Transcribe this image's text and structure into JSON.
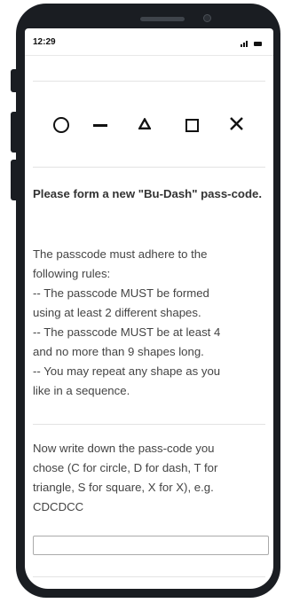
{
  "status_bar": {
    "time": "12:29"
  },
  "shapes": [
    {
      "name": "circle",
      "glyph": "circle-icon"
    },
    {
      "name": "dash",
      "glyph": "dash-icon"
    },
    {
      "name": "triangle",
      "glyph": "triangle-icon"
    },
    {
      "name": "square",
      "glyph": "square-icon"
    },
    {
      "name": "X",
      "glyph": "x-icon"
    }
  ],
  "instructions": {
    "title": "Please form a new \"Bu-Dash\" pass-code.",
    "rules_lines": [
      "The passcode must adhere to the",
      "following rules:",
      "-- The passcode MUST be formed",
      "using at least 2 different shapes.",
      "-- The passcode MUST be at least 4",
      "and no more than 9 shapes long.",
      "-- You may repeat any shape as you",
      "like in a sequence."
    ],
    "prompt_lines": [
      "Now write down the pass-code you",
      "chose (C for circle, D for dash, T for",
      "triangle, S for square, X for X), e.g.",
      "CDCDCC"
    ]
  },
  "answer_field": {
    "value": "",
    "placeholder": ""
  },
  "colors": {
    "phone_frame": "#1a1d22",
    "text": "#444444",
    "title_text": "#333333",
    "divider": "#e3e3e3"
  }
}
